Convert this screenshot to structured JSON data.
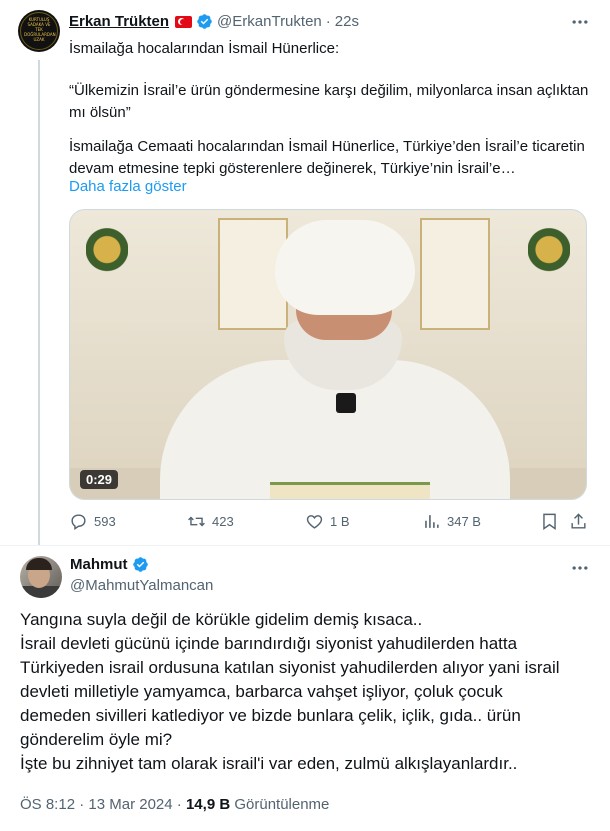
{
  "quoted_tweet": {
    "author_name": "Erkan Trükten",
    "author_handle": "@ErkanTrukten",
    "separator": "·",
    "time_ago": "22s",
    "line1": "İsmailağa hocalarından İsmail Hünerlice:",
    "line2": "“Ülkemizin İsrail’e ürün göndermesine karşı değilim, milyonlarca insan açlıktan mı ölsün”",
    "line3": "İsmailağa Cemaati hocalarından İsmail Hünerlice, Türkiye’den İsrail’e ticaretin devam etmesine tepki gösterenlere değinerek, Türkiye’nin İsrail’e…",
    "show_more": "Daha fazla göster",
    "video_duration": "0:29",
    "actions": {
      "replies": "593",
      "reposts": "423",
      "likes": "1 B",
      "views": "347 B"
    }
  },
  "reply": {
    "author_name": "Mahmut",
    "author_handle": "@MahmutYalmancan",
    "text_lines": [
      "Yangına suyla değil de körükle gidelim demiş kısaca..",
      "İsrail devleti gücünü içinde barındırdığı siyonist yahudilerden hatta",
      "Türkiyeden israil ordusuna katılan siyonist yahudilerden alıyor yani israil",
      "devleti milletiyle yamyamca, barbarca vahşet işliyor, çoluk çocuk",
      "demeden sivilleri katlediyor ve bizde bunlara çelik, içlik, gıda.. ürün",
      "gönderelim öyle mi?",
      "İşte bu zihniyet tam olarak israil'i var eden, zulmü alkışlayanlardır.."
    ],
    "time": "ÖS 8:12",
    "dot": "·",
    "date": "13 Mar 2024",
    "views_count": "14,9 B",
    "views_label": "Görüntülenme"
  },
  "avatar_text": "KURTULUŞ SADAKA VE TEK DOĞRULARDAN UZAK",
  "colors": {
    "accent": "#1d9bf0",
    "muted": "#536471",
    "text": "#0f1419"
  }
}
